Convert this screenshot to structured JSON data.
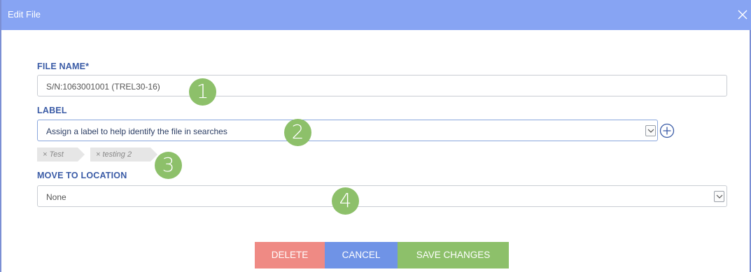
{
  "dialog": {
    "title": "Edit File"
  },
  "file_name": {
    "label": "FILE NAME*",
    "value": "S/N:1063001001 (TREL30-16)"
  },
  "label_field": {
    "label": "LABEL",
    "placeholder": "Assign a label to help identify the file in searches",
    "tags": [
      "Test",
      "testing 2"
    ]
  },
  "location": {
    "label": "MOVE TO LOCATION",
    "value": "None"
  },
  "badges": [
    "1",
    "2",
    "3",
    "4"
  ],
  "buttons": {
    "delete": "DELETE",
    "cancel": "CANCEL",
    "save": "SAVE CHANGES"
  },
  "colors": {
    "titlebar": "#87a4f3",
    "label_text": "#3a5ba6",
    "badge": "#8dc06a",
    "delete": "#ef8a84",
    "cancel": "#6f93e6",
    "save": "#8dc06a"
  },
  "icons": {
    "close": "close-icon",
    "add": "plus-circle-icon",
    "dropdown": "chevron-down-icon",
    "tag_remove": "x-icon"
  }
}
